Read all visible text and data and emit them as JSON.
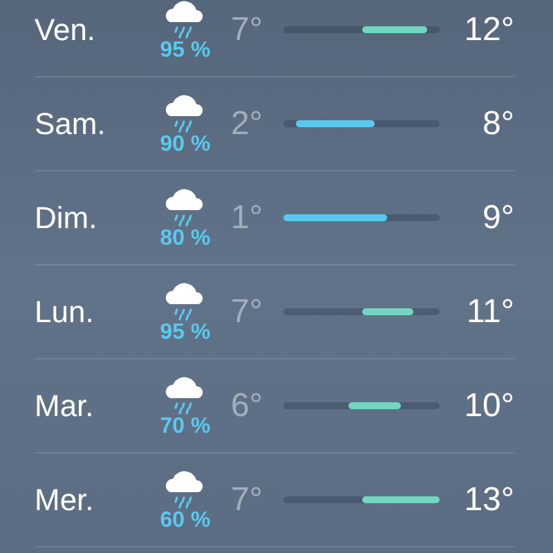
{
  "days": [
    {
      "day": "Ven.",
      "precipitation": "95 %",
      "low": "7°",
      "high": "12°"
    },
    {
      "day": "Sam.",
      "precipitation": "90 %",
      "low": "2°",
      "high": "8°"
    },
    {
      "day": "Dim.",
      "precipitation": "80 %",
      "low": "1°",
      "high": "9°"
    },
    {
      "day": "Lun.",
      "precipitation": "95 %",
      "low": "7°",
      "high": "11°"
    },
    {
      "day": "Mar.",
      "precipitation": "70 %",
      "low": "6°",
      "high": "10°"
    },
    {
      "day": "Mer.",
      "precipitation": "60 %",
      "low": "7°",
      "high": "13°"
    }
  ]
}
